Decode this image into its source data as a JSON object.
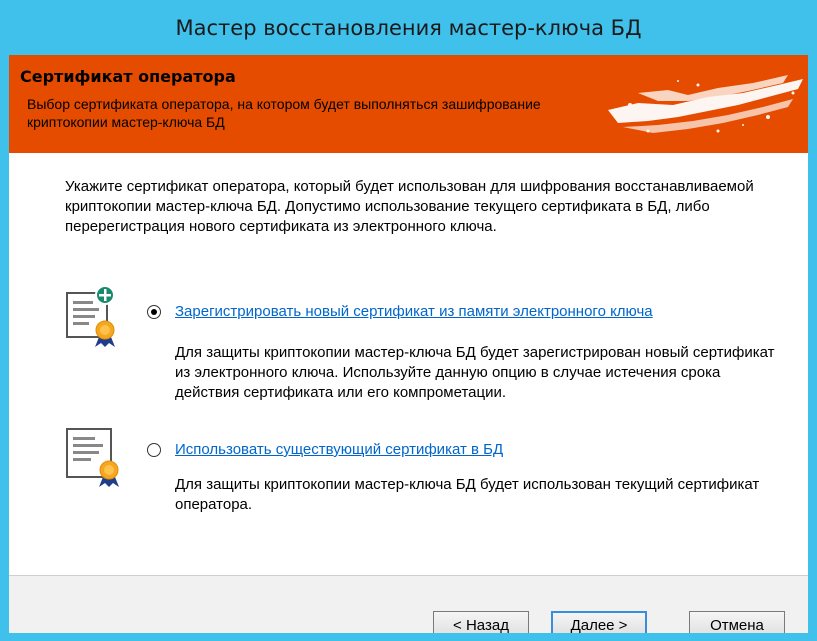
{
  "window": {
    "title": "Мастер восстановления мастер-ключа БД"
  },
  "banner": {
    "title": "Сертификат оператора",
    "subtitle": "Выбор сертификата оператора, на котором будет выполняться зашифрование криптокопии мастер-ключа БД"
  },
  "intro": "Укажите сертификат оператора, который будет использован для шифрования восстанавливаемой криптокопии мастер-ключа БД. Допустимо использование текущего сертификата в БД, либо перерегистрация нового сертификата из электронного ключа.",
  "options": [
    {
      "label": "Зарегистрировать новый сертификат из памяти электронного ключа",
      "description": "Для защиты криптокопии мастер-ключа БД будет зарегистрирован новый сертификат из электронного ключа. Используйте данную опцию в случае истечения срока действия сертификата или его компрометации.",
      "selected": true,
      "icon": "certificate-add-icon"
    },
    {
      "label": "Использовать существующий сертификат в БД",
      "description": "Для защиты криптокопии мастер-ключа БД будет использован текущий сертификат оператора.",
      "selected": false,
      "icon": "certificate-icon"
    }
  ],
  "buttons": {
    "back": "< Назад",
    "next": "Далее >",
    "cancel": "Отмена"
  },
  "colors": {
    "window_frame": "#3fc1ec",
    "banner": "#e64c00",
    "link": "#0066cc",
    "seal": "#f5a623",
    "plus": "#1a8a6e"
  }
}
